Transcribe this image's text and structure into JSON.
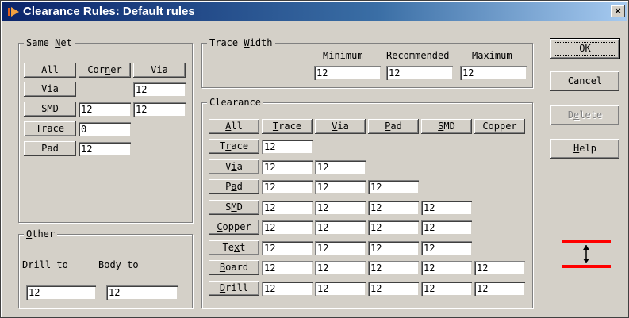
{
  "window": {
    "title": "Clearance Rules: Default rules",
    "close_label": "×"
  },
  "same_net": {
    "legend_pre": "Same ",
    "legend_u": "N",
    "legend_post": "et",
    "header": {
      "all": "All",
      "corner_pre": "Cor",
      "corner_u": "n",
      "corner_post": "er",
      "via": "Via"
    },
    "rows": [
      {
        "label": "Via",
        "corner": "",
        "via": "12"
      },
      {
        "label": "SMD",
        "corner": "12",
        "via": "12"
      },
      {
        "label": "Trace",
        "corner": "0"
      },
      {
        "label": "Pad",
        "corner": "12"
      }
    ]
  },
  "trace_width": {
    "legend_pre": "Trace ",
    "legend_u": "W",
    "legend_post": "idth",
    "labels": {
      "minimum": "Minimum",
      "recommended": "Recommended",
      "maximum": "Maximum"
    },
    "values": {
      "minimum": "12",
      "recommended": "12",
      "maximum": "12"
    }
  },
  "clearance": {
    "legend": "Clearance",
    "header": {
      "all_u": "A",
      "all_post": "ll",
      "trace_u": "T",
      "trace_post": "race",
      "via_u": "V",
      "via_post": "ia",
      "pad_u": "P",
      "pad_post": "ad",
      "smd_u": "S",
      "smd_post": "MD",
      "copper": "Copper"
    },
    "rows": [
      {
        "pre": "T",
        "u": "r",
        "post": "ace",
        "values": [
          "12"
        ]
      },
      {
        "pre": "V",
        "u": "i",
        "post": "a",
        "values": [
          "12",
          "12"
        ]
      },
      {
        "pre": "P",
        "u": "a",
        "post": "d",
        "values": [
          "12",
          "12",
          "12"
        ]
      },
      {
        "pre": "S",
        "u": "M",
        "post": "D",
        "values": [
          "12",
          "12",
          "12",
          "12"
        ]
      },
      {
        "pre": "",
        "u": "C",
        "post": "opper",
        "values": [
          "12",
          "12",
          "12",
          "12"
        ]
      },
      {
        "pre": "Te",
        "u": "x",
        "post": "t",
        "values": [
          "12",
          "12",
          "12",
          "12"
        ]
      },
      {
        "pre": "",
        "u": "B",
        "post": "oard",
        "values": [
          "12",
          "12",
          "12",
          "12",
          "12"
        ]
      },
      {
        "pre": "",
        "u": "D",
        "post": "rill",
        "values": [
          "12",
          "12",
          "12",
          "12",
          "12"
        ]
      }
    ]
  },
  "other": {
    "legend_u": "O",
    "legend_post": "ther",
    "drill_label": "Drill to",
    "body_label": "Body to",
    "drill_value": "12",
    "body_value": "12"
  },
  "buttons": {
    "ok": "OK",
    "cancel": "Cancel",
    "delete_u": "e",
    "delete_pre": "D",
    "delete_post": "lete",
    "help_u": "H",
    "help_post": "elp"
  },
  "colors": {
    "title_start": "#0a246a",
    "title_end": "#a6caf0",
    "clearance_icon": "#ff0000",
    "face": "#d4d0c8"
  },
  "icons": {
    "app": "app-icon",
    "clearance": "clearance-gap-icon"
  }
}
